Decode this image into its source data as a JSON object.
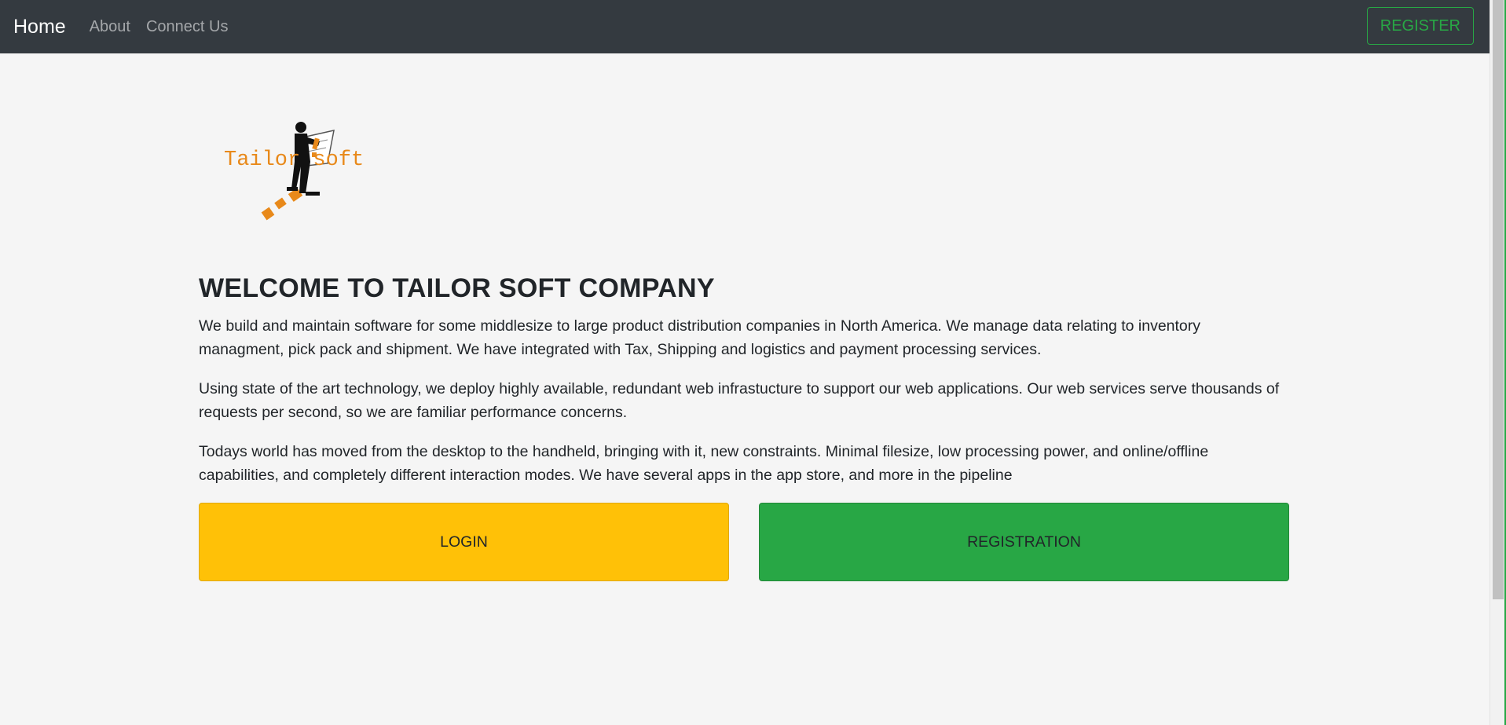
{
  "navbar": {
    "brand": "Home",
    "links": [
      "About",
      "Connect Us"
    ],
    "register_label": "REGISTER"
  },
  "logo": {
    "text": "Tailor soft",
    "accent_color": "#e8891a"
  },
  "main": {
    "title": "WELCOME TO TAILOR SOFT COMPANY",
    "paragraphs": [
      "We build and maintain software for some middlesize to large product distribution companies in North America. We manage data relating to inventory managment, pick pack and shipment. We have integrated with Tax, Shipping and logistics and payment processing services.",
      "Using state of the art technology, we deploy highly available, redundant web infrastucture to support our web applications. Our web services serve thousands of requests per second, so we are familiar performance concerns.",
      "Todays world has moved from the desktop to the handheld, bringing with it, new constraints. Minimal filesize, low processing power, and online/offline capabilities, and completely different interaction modes. We have several apps in the app store, and more in the pipeline"
    ],
    "login_label": "LOGIN",
    "registration_label": "REGISTRATION"
  },
  "colors": {
    "navbar_bg": "#343a40",
    "login_bg": "#ffc107",
    "registration_bg": "#28a745",
    "register_outline": "#28a745"
  }
}
